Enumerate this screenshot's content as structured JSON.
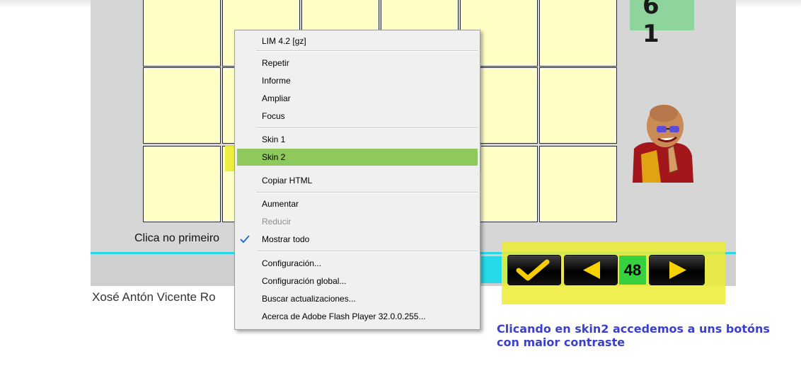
{
  "game": {
    "score_display": "6 1",
    "instruction": "Clica no primeiro",
    "counter": "48",
    "author": "Xosé Antón Vicente Ro",
    "annotation_note": "Clicando en skin2 accedemos a uns botóns con maior contraste",
    "colors": {
      "board": "#d6d6d6",
      "cell": "#ffffc6",
      "highlight": "#ecec32",
      "counter": "#37d140",
      "note": "#3a3fd1"
    }
  },
  "context_menu": {
    "items": [
      {
        "label": "LIM 4.2   [gz]"
      },
      {
        "label": "Repetir"
      },
      {
        "label": "Informe"
      },
      {
        "label": "Ampliar"
      },
      {
        "label": "Focus"
      },
      {
        "label": "Skin 1"
      },
      {
        "label": "Skin 2"
      },
      {
        "label": "Copiar HTML"
      },
      {
        "label": "Aumentar"
      },
      {
        "label": "Reducir",
        "disabled": true
      },
      {
        "label": "Mostrar todo",
        "checked": true
      },
      {
        "label": "Configuración..."
      },
      {
        "label": "Configuración global..."
      },
      {
        "label": "Buscar actualizaciones..."
      },
      {
        "label": "Acerca de Adobe Flash Player 32.0.0.255..."
      }
    ],
    "highlighted_item": "Skin 2"
  },
  "icons": [
    "check-button-icon",
    "previous-arrow-icon",
    "next-arrow-icon",
    "menu-checkmark-icon"
  ]
}
